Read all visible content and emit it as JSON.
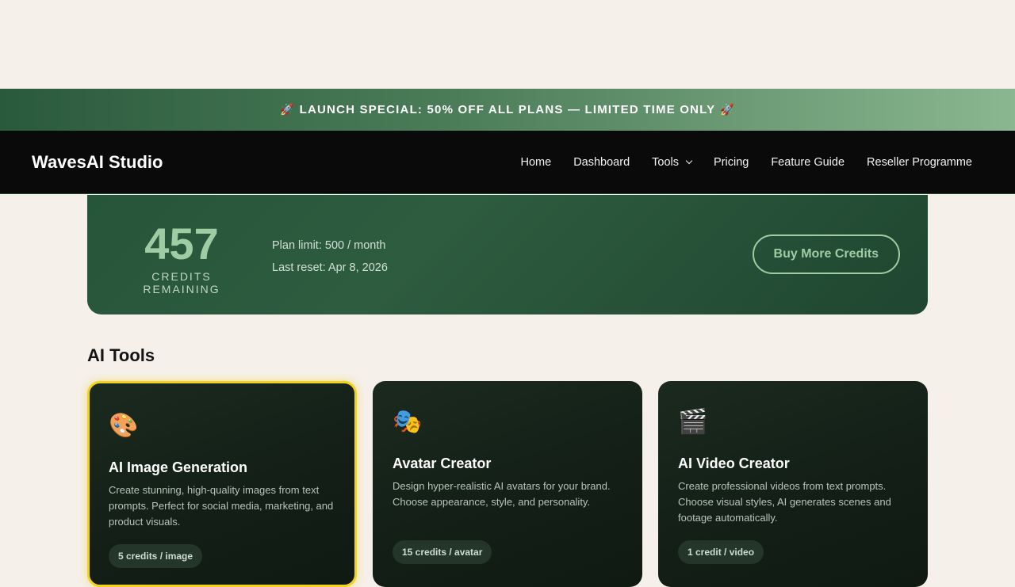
{
  "promo": {
    "rocket_left": "🚀",
    "text": "LAUNCH SPECIAL: 50% OFF ALL PLANS — LIMITED TIME ONLY",
    "rocket_right": "🚀"
  },
  "nav": {
    "brand": "WavesAI Studio",
    "links": {
      "home": "Home",
      "dashboard": "Dashboard",
      "tools": "Tools",
      "pricing": "Pricing",
      "feature_guide": "Feature Guide",
      "reseller": "Reseller Programme"
    }
  },
  "credits": {
    "count": "457",
    "caption": "CREDITS REMAINING",
    "plan_limit": "Plan limit: 500 / month",
    "last_reset": "Last reset: Apr 8, 2026",
    "buy_label": "Buy More Credits"
  },
  "tools_section": {
    "title": "AI Tools",
    "cards": [
      {
        "icon": "🎨",
        "icon_name": "palette-icon",
        "title": "AI Image Generation",
        "description": "Create stunning, high-quality images from text prompts. Perfect for social media, marketing, and product visuals.",
        "badge": "5 credits / image"
      },
      {
        "icon": "🎭",
        "icon_name": "theater-masks-icon",
        "title": "Avatar Creator",
        "description": "Design hyper-realistic AI avatars for your brand. Choose appearance, style, and personality.",
        "badge": "15 credits / avatar"
      },
      {
        "icon": "🎬",
        "icon_name": "clapperboard-icon",
        "title": "AI Video Creator",
        "description": "Create professional videos from text prompts. Choose visual styles, AI generates scenes and footage automatically.",
        "badge": "1 credit / video"
      }
    ]
  },
  "colors": {
    "accent_green": "#9fcca3",
    "selected_border": "#f2d21b",
    "nav_bg": "#0a0a0a",
    "page_bg": "#f5f0e9"
  }
}
